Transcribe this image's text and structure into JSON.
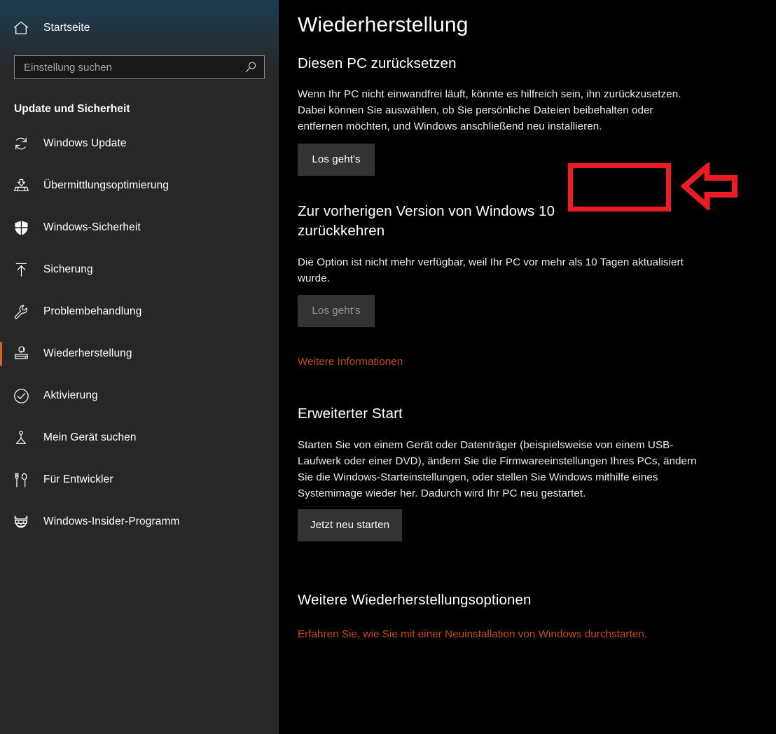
{
  "sidebar": {
    "home": {
      "label": "Startseite",
      "icon": "home-icon"
    },
    "search": {
      "placeholder": "Einstellung suchen",
      "value": "",
      "icon": "search-icon"
    },
    "category_title": "Update und Sicherheit",
    "accent_color": "#d8622a",
    "items": [
      {
        "label": "Windows Update",
        "icon": "refresh-icon",
        "selected": false
      },
      {
        "label": "Übermittlungsoptimierung",
        "icon": "delivery-optimization-icon",
        "selected": false
      },
      {
        "label": "Windows-Sicherheit",
        "icon": "shield-icon",
        "selected": false
      },
      {
        "label": "Sicherung",
        "icon": "backup-upload-icon",
        "selected": false
      },
      {
        "label": "Problembehandlung",
        "icon": "wrench-icon",
        "selected": false
      },
      {
        "label": "Wiederherstellung",
        "icon": "recovery-icon",
        "selected": true
      },
      {
        "label": "Aktivierung",
        "icon": "check-circle-icon",
        "selected": false
      },
      {
        "label": "Mein Gerät suchen",
        "icon": "find-my-device-icon",
        "selected": false
      },
      {
        "label": "Für Entwickler",
        "icon": "developer-tools-icon",
        "selected": false
      },
      {
        "label": "Windows-Insider-Programm",
        "icon": "insider-ninjacat-icon",
        "selected": false
      }
    ]
  },
  "main": {
    "page_title": "Wiederherstellung",
    "sections": {
      "reset": {
        "heading": "Diesen PC zurücksetzen",
        "body": "Wenn Ihr PC nicht einwandfrei läuft, könnte es hilfreich sein, ihn zurückzusetzen. Dabei können Sie auswählen, ob Sie persönliche Dateien beibehalten oder entfernen möchten, und Windows anschließend neu installieren.",
        "button_label": "Los geht's"
      },
      "rollback": {
        "heading": "Zur vorherigen Version von Windows 10 zurückkehren",
        "body": "Die Option ist nicht mehr verfügbar, weil Ihr PC vor mehr als 10 Tagen aktualisiert wurde.",
        "button_label": "Los geht's",
        "button_disabled": true,
        "link_label": "Weitere Informationen"
      },
      "advanced_startup": {
        "heading": "Erweiterter Start",
        "body": "Starten Sie von einem Gerät oder Datenträger (beispielsweise von einem USB-Laufwerk oder einer DVD), ändern Sie die Firmwareeinstellungen Ihres PCs, ändern Sie die Windows-Starteinstellungen, oder stellen Sie Windows mithilfe eines Systemimage wieder her. Dadurch wird Ihr PC neu gestartet.",
        "button_label": "Jetzt neu starten"
      },
      "more_options": {
        "heading": "Weitere Wiederherstellungsoptionen",
        "link_label": "Erfahren Sie, wie Sie mit einer Neuinstallation von Windows durchstarten."
      }
    },
    "link_color": "#c4491c"
  },
  "annotations": {
    "color": "#ec1c24",
    "highlight_box": {
      "target": "reset-get-started-button"
    },
    "arrow": {
      "direction": "left",
      "points_to": "reset-get-started-button"
    }
  }
}
